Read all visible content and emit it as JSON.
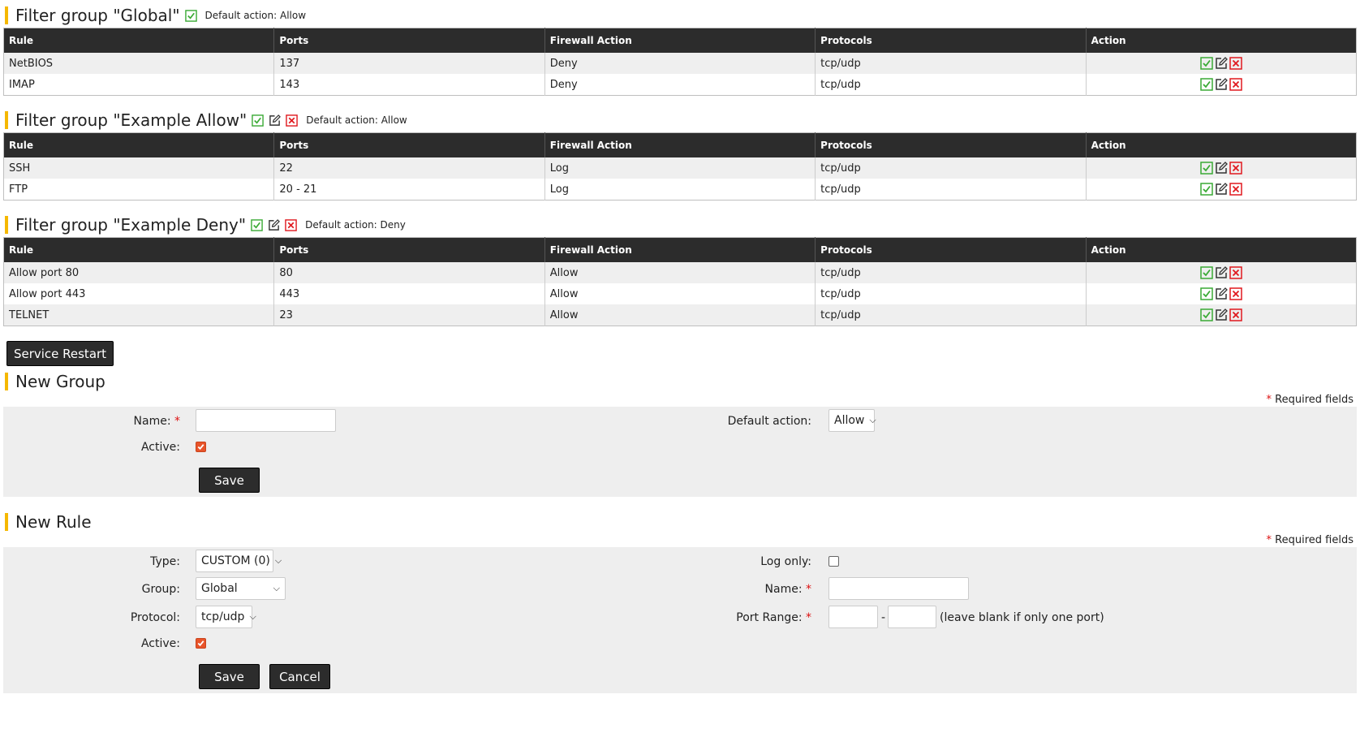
{
  "columns": [
    "Rule",
    "Ports",
    "Firewall Action",
    "Protocols",
    "Action"
  ],
  "groups": [
    {
      "title": "Filter group \"Global\"",
      "default_action": "Default action: Allow",
      "rows": [
        {
          "rule": "NetBIOS",
          "ports": "137",
          "fw_action": "Deny",
          "protocols": "tcp/udp"
        },
        {
          "rule": "IMAP",
          "ports": "143",
          "fw_action": "Deny",
          "protocols": "tcp/udp"
        }
      ]
    },
    {
      "title": "Filter group \"Example Allow\"",
      "default_action": "Default action: Allow",
      "rows": [
        {
          "rule": "SSH",
          "ports": "22",
          "fw_action": "Log",
          "protocols": "tcp/udp"
        },
        {
          "rule": "FTP",
          "ports": "20 - 21",
          "fw_action": "Log",
          "protocols": "tcp/udp"
        }
      ]
    },
    {
      "title": "Filter group \"Example Deny\"",
      "default_action": "Default action: Deny",
      "rows": [
        {
          "rule": "Allow port 80",
          "ports": "80",
          "fw_action": "Allow",
          "protocols": "tcp/udp"
        },
        {
          "rule": "Allow port 443",
          "ports": "443",
          "fw_action": "Allow",
          "protocols": "tcp/udp"
        },
        {
          "rule": "TELNET",
          "ports": "23",
          "fw_action": "Allow",
          "protocols": "tcp/udp"
        }
      ]
    }
  ],
  "service_restart_label": "Service Restart",
  "required_note": "Required fields",
  "required_star": "*",
  "new_group": {
    "title": "New Group",
    "name_label": "Name:",
    "name_value": "",
    "default_action_label": "Default action:",
    "default_action_value": "Allow",
    "active_label": "Active:",
    "active_checked": true,
    "save_label": "Save"
  },
  "new_rule": {
    "title": "New Rule",
    "type_label": "Type:",
    "type_value": "CUSTOM (0)",
    "group_label": "Group:",
    "group_value": "Global",
    "protocol_label": "Protocol:",
    "protocol_value": "tcp/udp",
    "active_label": "Active:",
    "active_checked": true,
    "log_only_label": "Log only:",
    "log_only_checked": false,
    "name_label": "Name:",
    "port_range_label": "Port Range:",
    "port_range_sep": "-",
    "port_range_hint": "(leave blank if only one port)",
    "save_label": "Save",
    "cancel_label": "Cancel"
  },
  "colors": {
    "accent": "#f5b800",
    "header_bg": "#2c2c2c",
    "enable_icon": "#3aaa35",
    "delete_icon": "#e0191f",
    "checkbox": "#e8542a"
  },
  "icons": {
    "enable": "checkbox-check-icon",
    "edit": "edit-pencil-icon",
    "delete": "delete-x-icon"
  }
}
